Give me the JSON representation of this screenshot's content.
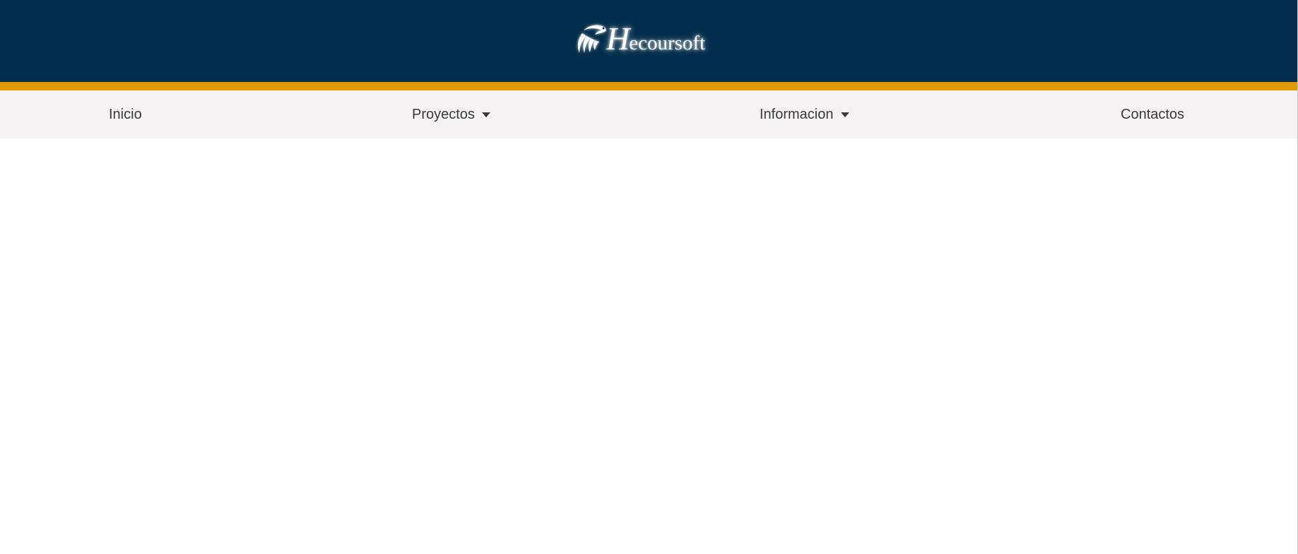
{
  "header": {
    "brand": {
      "initial": "H",
      "rest": "ecoursoft",
      "icon": "eagle-icon"
    },
    "colors": {
      "background": "#022d4c",
      "accent": "#e09a08"
    }
  },
  "nav": {
    "items": [
      {
        "label": "Inicio",
        "has_dropdown": false
      },
      {
        "label": "Proyectos",
        "has_dropdown": true,
        "icon": "caret-down-icon"
      },
      {
        "label": "Informacion",
        "has_dropdown": true,
        "icon": "caret-down-icon"
      },
      {
        "label": "Contactos",
        "has_dropdown": false
      }
    ],
    "background": "#f4f2f2",
    "text_color": "#3a3a3a"
  }
}
